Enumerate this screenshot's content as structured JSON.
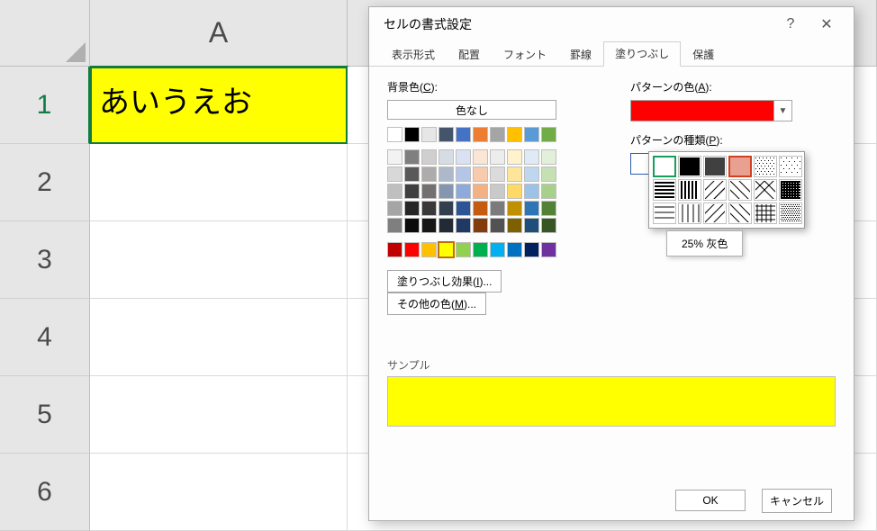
{
  "sheet": {
    "col_header": "A",
    "row_headers": [
      "1",
      "2",
      "3",
      "4",
      "5",
      "6"
    ],
    "cell_A1": "あいうえお"
  },
  "dialog": {
    "title": "セルの書式設定",
    "help_icon": "?",
    "close_icon": "✕",
    "tabs": {
      "t1": "表示形式",
      "t2": "配置",
      "t3": "フォント",
      "t4": "罫線",
      "t5": "塗りつぶし",
      "t6": "保護"
    },
    "left": {
      "bgcolor_label": "背景色(C):",
      "nocolor": "色なし",
      "fill_effects_btn": "塗りつぶし効果(I)...",
      "more_colors_btn": "その他の色(M)...",
      "theme_row": [
        "#ffffff",
        "#000000",
        "#e7e6e6",
        "#44546a",
        "#4472c4",
        "#ed7d31",
        "#a5a5a5",
        "#ffc000",
        "#5b9bd5",
        "#70ad47"
      ],
      "theme_shades": [
        [
          "#f2f2f2",
          "#7f7f7f",
          "#d0cece",
          "#d6dce4",
          "#d9e1f2",
          "#fbe5d5",
          "#ededed",
          "#fff2cc",
          "#deebf6",
          "#e2efd9"
        ],
        [
          "#d8d8d8",
          "#595959",
          "#aeabab",
          "#adb9ca",
          "#b4c6e7",
          "#f7cbac",
          "#dbdbdb",
          "#fee599",
          "#bdd7ee",
          "#c5e0b3"
        ],
        [
          "#bfbfbf",
          "#3f3f3f",
          "#757070",
          "#8496b0",
          "#8eaadb",
          "#f4b183",
          "#c9c9c9",
          "#ffd965",
          "#9cc3e5",
          "#a8d08d"
        ],
        [
          "#a5a5a5",
          "#262626",
          "#3a3838",
          "#323f4f",
          "#2f5496",
          "#c55a11",
          "#7b7b7b",
          "#bf9000",
          "#2e75b5",
          "#538135"
        ],
        [
          "#7f7f7f",
          "#0c0c0c",
          "#171616",
          "#222a35",
          "#1f3864",
          "#833c0b",
          "#525252",
          "#7f6000",
          "#1e4e79",
          "#375623"
        ]
      ],
      "standard_row": [
        "#c00000",
        "#ff0000",
        "#ffc000",
        "#ffff00",
        "#92d050",
        "#00b050",
        "#00b0f0",
        "#0070c0",
        "#002060",
        "#7030a0"
      ],
      "selected_standard_index": 3
    },
    "right": {
      "pattern_color_label": "パターンの色(A):",
      "pattern_color_value": "#ff0000",
      "pattern_type_label": "パターンの種類(P):",
      "tooltip": "25% 灰色"
    },
    "sample_label": "サンプル",
    "sample_color": "#ffff00",
    "ok": "OK",
    "cancel": "キャンセル"
  }
}
